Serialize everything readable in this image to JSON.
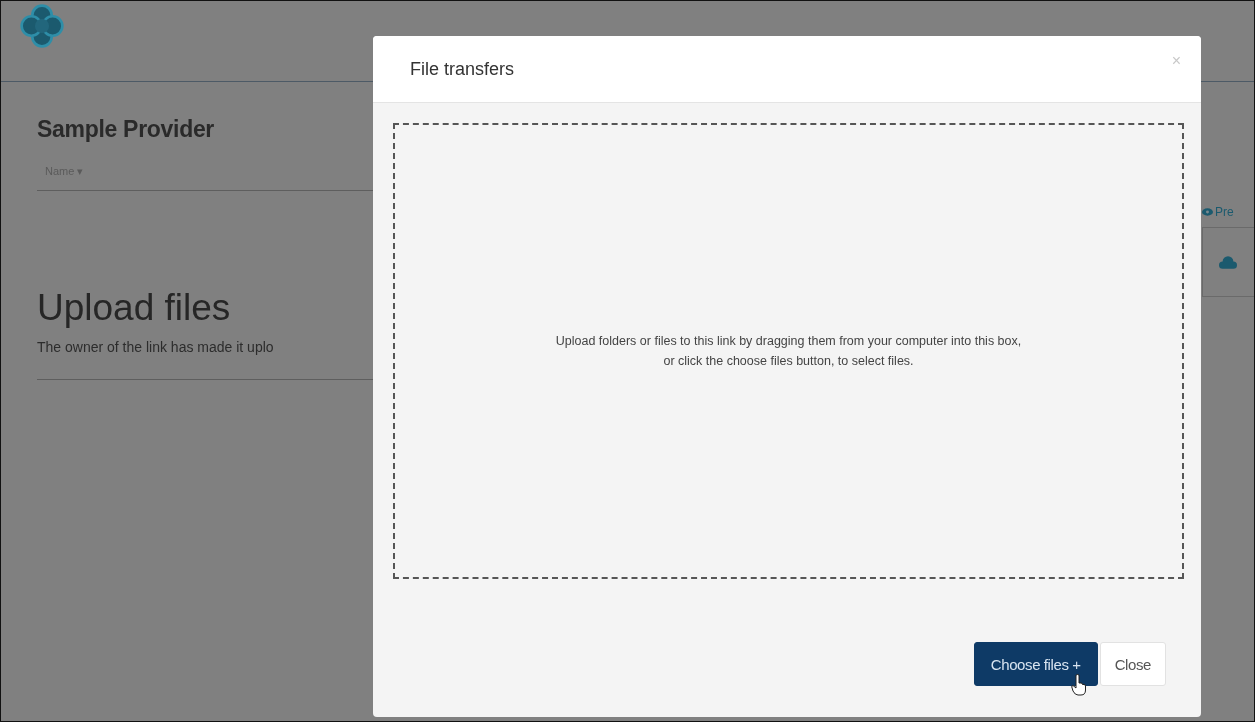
{
  "page": {
    "title": "Sample Provider",
    "sort_label": "Name ▾",
    "heading": "Upload files",
    "description": "The owner of the link has made it uplo",
    "preview_link": "Pre"
  },
  "dialog": {
    "title": "File transfers",
    "close_glyph": "×",
    "dropzone": {
      "text_lines": [
        "Upload folders or files to this link by dragging them from your computer into this box,",
        "or click the choose files button, to select files."
      ]
    },
    "buttons": [
      {
        "label": "Choose files +",
        "kind": "primary"
      },
      {
        "label": "Close",
        "kind": "secondary"
      }
    ]
  }
}
